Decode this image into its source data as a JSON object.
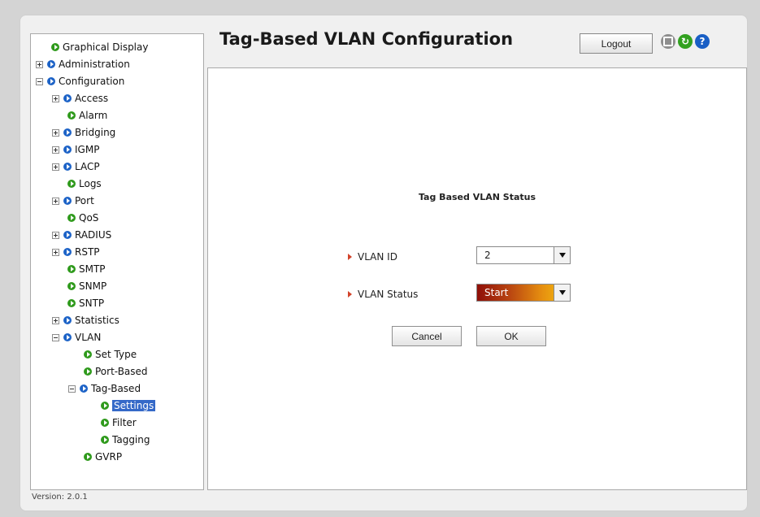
{
  "header": {
    "title": "Tag-Based VLAN Configuration",
    "logout_label": "Logout",
    "icons": [
      "save-icon",
      "refresh-icon",
      "help-icon"
    ]
  },
  "sidebar": {
    "items": [
      {
        "label": "Graphical Display",
        "icon": "green-arrow"
      },
      {
        "label": "Administration",
        "icon": "blue-arrow",
        "expander": "plus"
      },
      {
        "label": "Configuration",
        "icon": "blue-arrow",
        "expander": "minus"
      },
      {
        "label": "Access",
        "icon": "blue-arrow",
        "expander": "plus"
      },
      {
        "label": "Alarm",
        "icon": "green-arrow"
      },
      {
        "label": "Bridging",
        "icon": "blue-arrow",
        "expander": "plus"
      },
      {
        "label": "IGMP",
        "icon": "blue-arrow",
        "expander": "plus"
      },
      {
        "label": "LACP",
        "icon": "blue-arrow",
        "expander": "plus"
      },
      {
        "label": "Logs",
        "icon": "green-arrow"
      },
      {
        "label": "Port",
        "icon": "blue-arrow",
        "expander": "plus"
      },
      {
        "label": "QoS",
        "icon": "green-arrow"
      },
      {
        "label": "RADIUS",
        "icon": "blue-arrow",
        "expander": "plus"
      },
      {
        "label": "RSTP",
        "icon": "blue-arrow",
        "expander": "plus"
      },
      {
        "label": "SMTP",
        "icon": "green-arrow"
      },
      {
        "label": "SNMP",
        "icon": "green-arrow"
      },
      {
        "label": "SNTP",
        "icon": "green-arrow"
      },
      {
        "label": "Statistics",
        "icon": "blue-arrow",
        "expander": "plus"
      },
      {
        "label": "VLAN",
        "icon": "blue-arrow",
        "expander": "minus"
      },
      {
        "label": "Set Type",
        "icon": "green-arrow"
      },
      {
        "label": "Port-Based",
        "icon": "green-arrow"
      },
      {
        "label": "Tag-Based",
        "icon": "blue-arrow",
        "expander": "minus"
      },
      {
        "label": "Settings",
        "icon": "green-arrow",
        "selected": true
      },
      {
        "label": "Filter",
        "icon": "green-arrow"
      },
      {
        "label": "Tagging",
        "icon": "green-arrow"
      },
      {
        "label": "GVRP",
        "icon": "green-arrow"
      }
    ],
    "version": "Version: 2.0.1"
  },
  "main": {
    "section_title": "Tag Based VLAN Status",
    "vlan_id_label": "VLAN ID",
    "vlan_id_value": "2",
    "vlan_status_label": "VLAN Status",
    "vlan_status_value": "Start",
    "cancel_label": "Cancel",
    "ok_label": "OK"
  },
  "colors": {
    "selected_bg": "#3569c8",
    "arrow_red": "#d2432a",
    "status_gradient_start": "#8f0f08",
    "status_gradient_end": "#f5c10f"
  }
}
